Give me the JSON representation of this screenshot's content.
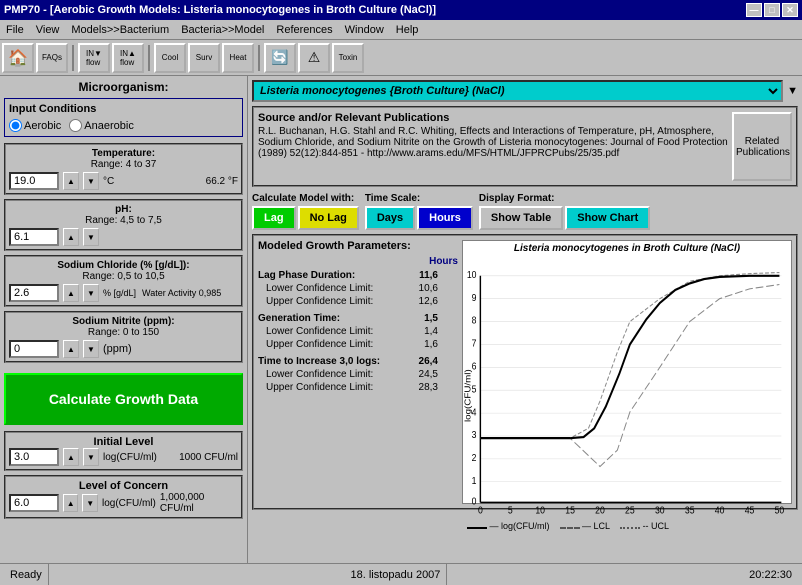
{
  "titleBar": {
    "title": "PMP70 - [Aerobic Growth Models: Listeria monocytogenes in Broth Culture (NaCl)]",
    "minBtn": "—",
    "maxBtn": "□",
    "closeBtn": "✕"
  },
  "menuBar": {
    "items": [
      "File",
      "View",
      "Models>>Bacterium",
      "Bacteria>>Model",
      "References",
      "Window",
      "Help"
    ]
  },
  "toolbar": {
    "buttons": [
      "FAQs",
      "IN▼\nflow",
      "IN▲\nflow",
      "Cool",
      "Surv",
      "Heat",
      "🔄",
      "⚠",
      "Toxin"
    ]
  },
  "leftPanel": {
    "microorganism": "Microorganism:",
    "inputConditions": {
      "title": "Input Conditions",
      "aerobicLabel": "Aerobic",
      "anaerobicLabel": "Anaerobic",
      "aerobicChecked": true
    },
    "temperature": {
      "title": "Temperature:",
      "range": "Range: 4 to 37",
      "value": "19.0",
      "fahrenheit": "66.2 °F",
      "unit": "°C"
    },
    "ph": {
      "title": "pH:",
      "range": "Range: 4,5 to 7,5",
      "value": "6.1"
    },
    "sodiumChloride": {
      "title": "Sodium Chloride (% [g/dL]):",
      "range": "Range: 0,5 to 10,5",
      "value": "2.6",
      "unit": "% [g/dL]",
      "waterActivity": "Water Activity 0,985"
    },
    "sodiumNitrite": {
      "title": "Sodium Nitrite (ppm):",
      "range": "Range: 0 to 150",
      "value": "0",
      "unit": "(ppm)"
    },
    "calcBtn": "Calculate Growth Data",
    "initialLevel": {
      "title": "Initial Level",
      "value": "3.0",
      "unit": "log(CFU/ml)",
      "cfuValue": "1000 CFU/ml"
    },
    "levelOfConcern": {
      "title": "Level of Concern",
      "value": "6.0",
      "unit": "log(CFU/ml)",
      "cfuValue": "1,000,000 CFU/ml"
    }
  },
  "rightPanel": {
    "organism": "Listeria monocytogenes {Broth Culture} (NaCl)",
    "sourceTitle": "Source and/or Relevant Publications",
    "sourceText": "R.L. Buchanan, H.G. Stahl and R.C. Whiting, Effects and Interactions of Temperature, pH, Atmosphere, Sodium Chloride, and Sodium Nitrite on the Growth of Listeria monocytogenes: Journal of Food Protection (1989) 52(12):844-851 - http://www.arams.edu/MFS/HTML/JFPRCPubs/25/35.pdf",
    "relatedBtn": "Related\nPublications",
    "calculateModel": {
      "title": "Calculate Model with:",
      "lagBtn": "Lag",
      "noLagBtn": "No Lag",
      "noLagActive": true
    },
    "timeScale": {
      "title": "Time Scale:",
      "daysBtn": "Days",
      "hoursBtn": "Hours",
      "hoursActive": true
    },
    "displayFormat": {
      "title": "Display Format:",
      "showTableBtn": "Show Table",
      "showChartBtn": "Show Chart",
      "showChartActive": true
    },
    "modeledGrowth": {
      "title": "Modeled Growth Parameters:",
      "hoursHeader": "Hours",
      "lagPhase": {
        "label": "Lag Phase Duration:",
        "value": "11,6",
        "lower": {
          "label": "Lower Confidence Limit:",
          "value": "10,6"
        },
        "upper": {
          "label": "Upper Confidence Limit:",
          "value": "12,6"
        }
      },
      "generationTime": {
        "label": "Generation Time:",
        "value": "1,5",
        "lower": {
          "label": "Lower Confidence Limit:",
          "value": "1,4"
        },
        "upper": {
          "label": "Upper Confidence Limit:",
          "value": "1,6"
        }
      },
      "timeIncrease": {
        "label": "Time to Increase 3,0 logs:",
        "value": "26,4",
        "lower": {
          "label": "Lower Confidence Limit:",
          "value": "24,5"
        },
        "upper": {
          "label": "Upper Confidence Limit:",
          "value": "28,3"
        }
      }
    },
    "chart": {
      "title": "Listeria monocytogenes in Broth Culture (NaCl)",
      "yAxis": "log(CFU/ml)",
      "xAxis": "Hours",
      "yLabels": [
        "10",
        "9",
        "8",
        "7",
        "6",
        "5",
        "4",
        "3",
        "2",
        "1",
        "0"
      ],
      "xLabels": [
        "0",
        "5",
        "10",
        "15",
        "20",
        "25",
        "30",
        "35",
        "40",
        "45",
        "50"
      ],
      "legend": {
        "main": "— log(CFU/ml)",
        "lcl": "— LCL",
        "ucl": "-- UCL"
      }
    }
  },
  "statusBar": {
    "ready": "Ready",
    "date": "18. listopadu 2007",
    "time": "20:22:30"
  }
}
